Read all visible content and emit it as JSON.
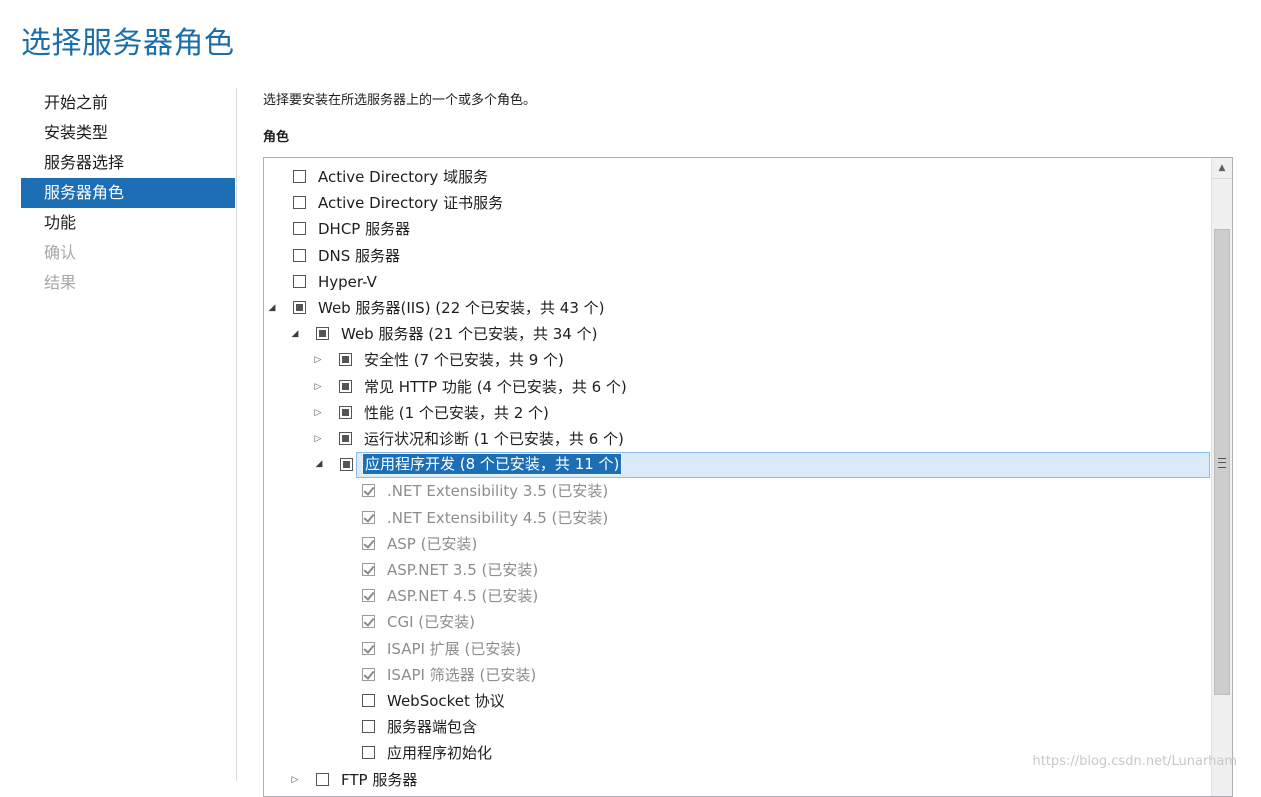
{
  "page": {
    "title": "选择服务器角色"
  },
  "nav": {
    "items": [
      {
        "label": "开始之前",
        "state": "normal"
      },
      {
        "label": "安装类型",
        "state": "normal"
      },
      {
        "label": "服务器选择",
        "state": "normal"
      },
      {
        "label": "服务器角色",
        "state": "selected"
      },
      {
        "label": "功能",
        "state": "normal"
      },
      {
        "label": "确认",
        "state": "disabled"
      },
      {
        "label": "结果",
        "state": "disabled"
      }
    ]
  },
  "main": {
    "description": "选择要安装在所选服务器上的一个或多个角色。",
    "roles_heading": "角色",
    "roles": [
      {
        "label": "Active Directory 域服务",
        "level": 0,
        "expander": "none",
        "check": "unchecked"
      },
      {
        "label": "Active Directory 证书服务",
        "level": 0,
        "expander": "none",
        "check": "unchecked"
      },
      {
        "label": "DHCP 服务器",
        "level": 0,
        "expander": "none",
        "check": "unchecked"
      },
      {
        "label": "DNS 服务器",
        "level": 0,
        "expander": "none",
        "check": "unchecked"
      },
      {
        "label": "Hyper-V",
        "level": 0,
        "expander": "none",
        "check": "unchecked"
      },
      {
        "label": "Web 服务器(IIS) (22 个已安装，共 43 个)",
        "level": 0,
        "expander": "expanded",
        "check": "partial"
      },
      {
        "label": "Web 服务器 (21 个已安装，共 34 个)",
        "level": 1,
        "expander": "expanded",
        "check": "partial"
      },
      {
        "label": "安全性 (7 个已安装，共 9 个)",
        "level": 2,
        "expander": "collapsed",
        "check": "partial"
      },
      {
        "label": "常见 HTTP 功能 (4 个已安装，共 6 个)",
        "level": 2,
        "expander": "collapsed",
        "check": "partial"
      },
      {
        "label": "性能 (1 个已安装，共 2 个)",
        "level": 2,
        "expander": "collapsed",
        "check": "partial"
      },
      {
        "label": "运行状况和诊断 (1 个已安装，共 6 个)",
        "level": 2,
        "expander": "collapsed",
        "check": "partial"
      },
      {
        "label": "应用程序开发 (8 个已安装，共 11 个)",
        "level": 2,
        "expander": "expanded",
        "check": "partial",
        "selected": true
      },
      {
        "label": ".NET Extensibility 3.5 (已安装)",
        "level": 3,
        "expander": "none",
        "check": "checked-installed"
      },
      {
        "label": ".NET Extensibility 4.5 (已安装)",
        "level": 3,
        "expander": "none",
        "check": "checked-installed"
      },
      {
        "label": "ASP (已安装)",
        "level": 3,
        "expander": "none",
        "check": "checked-installed"
      },
      {
        "label": "ASP.NET 3.5 (已安装)",
        "level": 3,
        "expander": "none",
        "check": "checked-installed"
      },
      {
        "label": "ASP.NET 4.5 (已安装)",
        "level": 3,
        "expander": "none",
        "check": "checked-installed"
      },
      {
        "label": "CGI (已安装)",
        "level": 3,
        "expander": "none",
        "check": "checked-installed"
      },
      {
        "label": "ISAPI 扩展 (已安装)",
        "level": 3,
        "expander": "none",
        "check": "checked-installed"
      },
      {
        "label": "ISAPI 筛选器 (已安装)",
        "level": 3,
        "expander": "none",
        "check": "checked-installed"
      },
      {
        "label": "WebSocket 协议",
        "level": 3,
        "expander": "none",
        "check": "unchecked"
      },
      {
        "label": "服务器端包含",
        "level": 3,
        "expander": "none",
        "check": "unchecked"
      },
      {
        "label": "应用程序初始化",
        "level": 3,
        "expander": "none",
        "check": "unchecked"
      },
      {
        "label": "FTP 服务器",
        "level": 1,
        "expander": "collapsed",
        "check": "unchecked"
      }
    ]
  },
  "icons": {
    "expanded": "expanded-triangle-icon",
    "collapsed": "collapsed-triangle-icon",
    "scroll_up": "scroll-up-arrow-icon",
    "scroll_grip": "scroll-grip-icon"
  },
  "watermark": "https://blog.csdn.net/Lunarham"
}
